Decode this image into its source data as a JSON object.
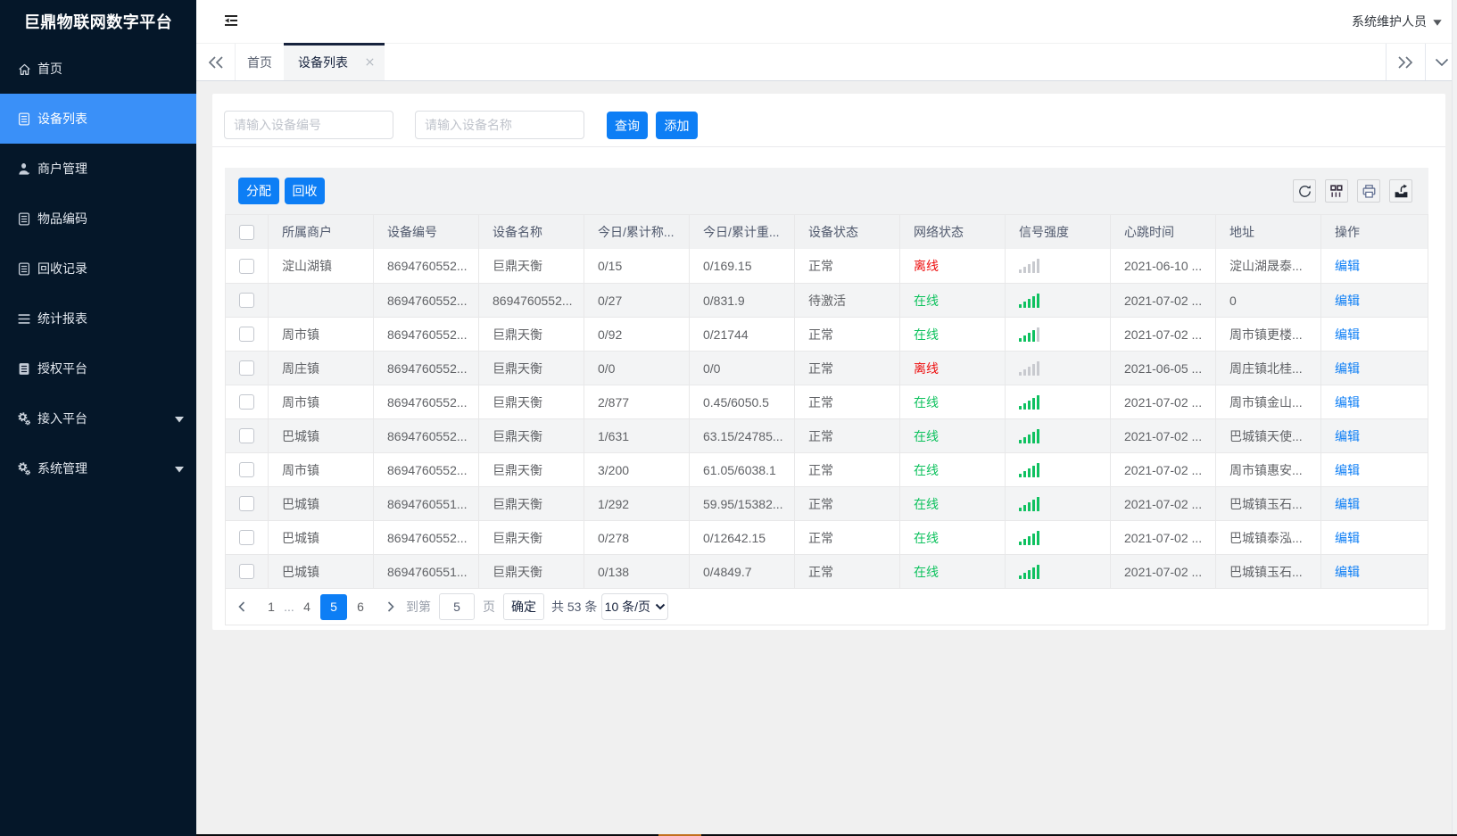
{
  "app": {
    "title": "巨鼎物联网数字平台"
  },
  "header": {
    "user": "系统维护人员"
  },
  "sidebar": {
    "items": [
      {
        "label": "首页",
        "icon": "home-icon",
        "active": false,
        "arrow": false
      },
      {
        "label": "设备列表",
        "icon": "device-list-icon",
        "active": true,
        "arrow": false
      },
      {
        "label": "商户管理",
        "icon": "person-icon",
        "active": false,
        "arrow": false
      },
      {
        "label": "物品编码",
        "icon": "item-code-icon",
        "active": false,
        "arrow": false
      },
      {
        "label": "回收记录",
        "icon": "recycle-record-icon",
        "active": false,
        "arrow": false
      },
      {
        "label": "统计报表",
        "icon": "report-lines-icon",
        "active": false,
        "arrow": false
      },
      {
        "label": "授权平台",
        "icon": "authorize-icon",
        "active": false,
        "arrow": false
      },
      {
        "label": "接入平台",
        "icon": "gear-icon",
        "active": false,
        "arrow": true
      },
      {
        "label": "系统管理",
        "icon": "gear-icon",
        "active": false,
        "arrow": true
      }
    ]
  },
  "tabs": {
    "items": [
      {
        "label": "首页",
        "active": false,
        "closable": false
      },
      {
        "label": "设备列表",
        "active": true,
        "closable": true
      }
    ]
  },
  "search": {
    "device_no_placeholder": "请输入设备编号",
    "device_name_placeholder": "请输入设备名称",
    "query_label": "查询",
    "add_label": "添加"
  },
  "toolbar": {
    "assign_label": "分配",
    "recycle_label": "回收",
    "icons": [
      "refresh-icon",
      "columns-grid-icon",
      "printer-icon",
      "export-icon"
    ]
  },
  "table": {
    "columns": [
      "所属商户",
      "设备编号",
      "设备名称",
      "今日/累计称...",
      "今日/累计重...",
      "设备状态",
      "网络状态",
      "信号强度",
      "心跳时间",
      "地址",
      "操作"
    ],
    "edit_label": "编辑",
    "rows": [
      {
        "merchant": "淀山湖镇",
        "device_no": "8694760552...",
        "device_name": "巨鼎天衡",
        "today_count": "0/15",
        "today_weight": "0/169.15",
        "device_status": "正常",
        "network": "离线",
        "online": false,
        "signal_lit": 0,
        "heartbeat": "2021-06-10 ...",
        "address": "淀山湖晟泰..."
      },
      {
        "merchant": "",
        "device_no": "8694760552...",
        "device_name": "8694760552...",
        "today_count": "0/27",
        "today_weight": "0/831.9",
        "device_status": "待激活",
        "network": "在线",
        "online": true,
        "signal_lit": 5,
        "heartbeat": "2021-07-02 ...",
        "address": "0"
      },
      {
        "merchant": "周市镇",
        "device_no": "8694760552...",
        "device_name": "巨鼎天衡",
        "today_count": "0/92",
        "today_weight": "0/21744",
        "device_status": "正常",
        "network": "在线",
        "online": true,
        "signal_lit": 4,
        "heartbeat": "2021-07-02 ...",
        "address": "周市镇更楼..."
      },
      {
        "merchant": "周庄镇",
        "device_no": "8694760552...",
        "device_name": "巨鼎天衡",
        "today_count": "0/0",
        "today_weight": "0/0",
        "device_status": "正常",
        "network": "离线",
        "online": false,
        "signal_lit": 0,
        "heartbeat": "2021-06-05 ...",
        "address": "周庄镇北桂..."
      },
      {
        "merchant": "周市镇",
        "device_no": "8694760552...",
        "device_name": "巨鼎天衡",
        "today_count": "2/877",
        "today_weight": "0.45/6050.5",
        "device_status": "正常",
        "network": "在线",
        "online": true,
        "signal_lit": 5,
        "heartbeat": "2021-07-02 ...",
        "address": "周市镇金山..."
      },
      {
        "merchant": "巴城镇",
        "device_no": "8694760552...",
        "device_name": "巨鼎天衡",
        "today_count": "1/631",
        "today_weight": "63.15/24785...",
        "device_status": "正常",
        "network": "在线",
        "online": true,
        "signal_lit": 5,
        "heartbeat": "2021-07-02 ...",
        "address": "巴城镇天使..."
      },
      {
        "merchant": "周市镇",
        "device_no": "8694760552...",
        "device_name": "巨鼎天衡",
        "today_count": "3/200",
        "today_weight": "61.05/6038.1",
        "device_status": "正常",
        "network": "在线",
        "online": true,
        "signal_lit": 5,
        "heartbeat": "2021-07-02 ...",
        "address": "周市镇惠安..."
      },
      {
        "merchant": "巴城镇",
        "device_no": "8694760551...",
        "device_name": "巨鼎天衡",
        "today_count": "1/292",
        "today_weight": "59.95/15382...",
        "device_status": "正常",
        "network": "在线",
        "online": true,
        "signal_lit": 5,
        "heartbeat": "2021-07-02 ...",
        "address": "巴城镇玉石..."
      },
      {
        "merchant": "巴城镇",
        "device_no": "8694760552...",
        "device_name": "巨鼎天衡",
        "today_count": "0/278",
        "today_weight": "0/12642.15",
        "device_status": "正常",
        "network": "在线",
        "online": true,
        "signal_lit": 5,
        "heartbeat": "2021-07-02 ...",
        "address": "巴城镇泰泓..."
      },
      {
        "merchant": "巴城镇",
        "device_no": "8694760551...",
        "device_name": "巨鼎天衡",
        "today_count": "0/138",
        "today_weight": "0/4849.7",
        "device_status": "正常",
        "network": "在线",
        "online": true,
        "signal_lit": 5,
        "heartbeat": "2021-07-02 ...",
        "address": "巴城镇玉石..."
      }
    ]
  },
  "pagination": {
    "pages": [
      "1",
      "...",
      "4",
      "5",
      "6"
    ],
    "active_page": "5",
    "goto_label": "到第",
    "goto_value": "5",
    "page_unit_label": "页",
    "confirm_label": "确定",
    "total_label": "共 53 条",
    "page_size_label": "10 条/页"
  },
  "colors": {
    "primary": "#0d7ef5",
    "online_green": "#0ec25e",
    "offline_red": "#ed0e0e",
    "sidebar_bg": "#051729"
  }
}
